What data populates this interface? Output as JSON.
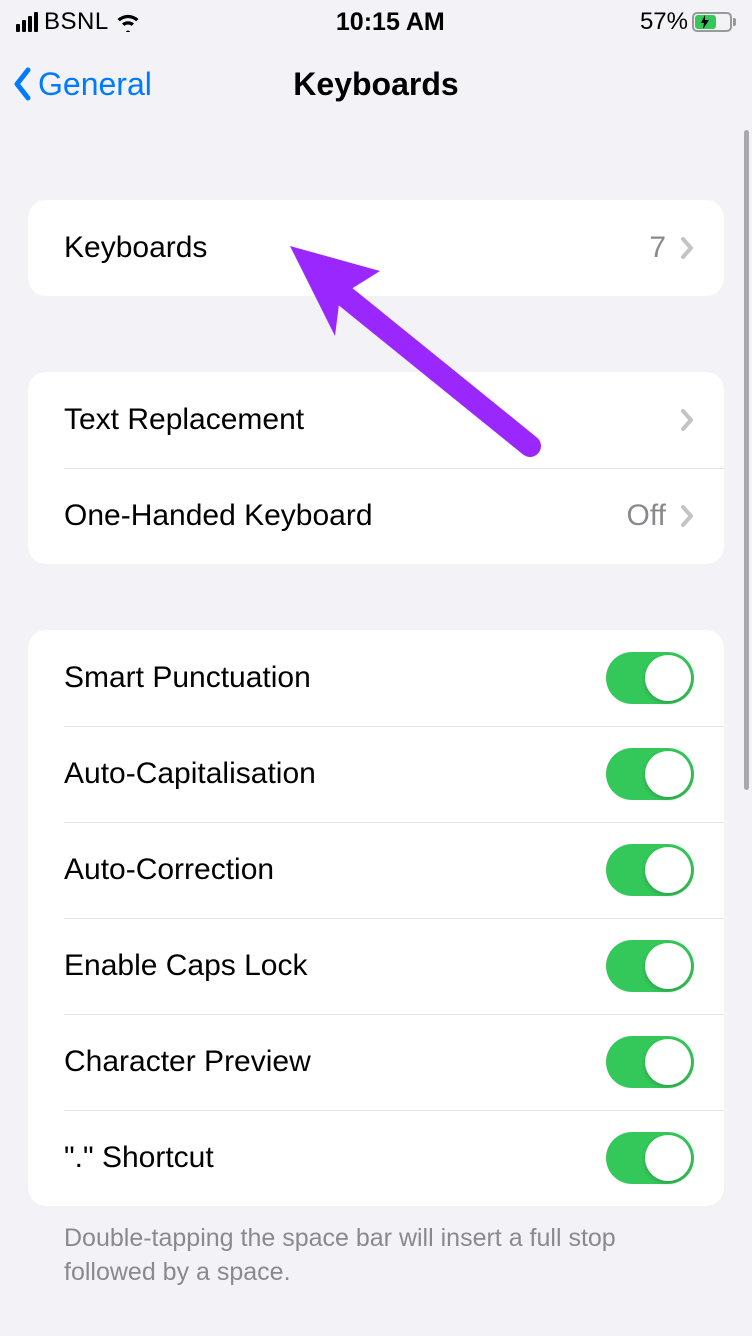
{
  "status": {
    "carrier": "BSNL",
    "time": "10:15 AM",
    "battery_pct": "57%"
  },
  "nav": {
    "back_label": "General",
    "title": "Keyboards"
  },
  "group1": {
    "keyboards": {
      "label": "Keyboards",
      "value": "7"
    }
  },
  "group2": {
    "text_replacement": {
      "label": "Text Replacement"
    },
    "one_handed": {
      "label": "One-Handed Keyboard",
      "value": "Off"
    }
  },
  "group3": {
    "smart_punctuation": {
      "label": "Smart Punctuation",
      "on": true
    },
    "auto_capitalisation": {
      "label": "Auto-Capitalisation",
      "on": true
    },
    "auto_correction": {
      "label": "Auto-Correction",
      "on": true
    },
    "enable_caps_lock": {
      "label": "Enable Caps Lock",
      "on": true
    },
    "character_preview": {
      "label": "Character Preview",
      "on": true
    },
    "dot_shortcut": {
      "label": "\".\" Shortcut",
      "on": true
    }
  },
  "footer_note": "Double-tapping the space bar will insert a full stop followed by a space."
}
